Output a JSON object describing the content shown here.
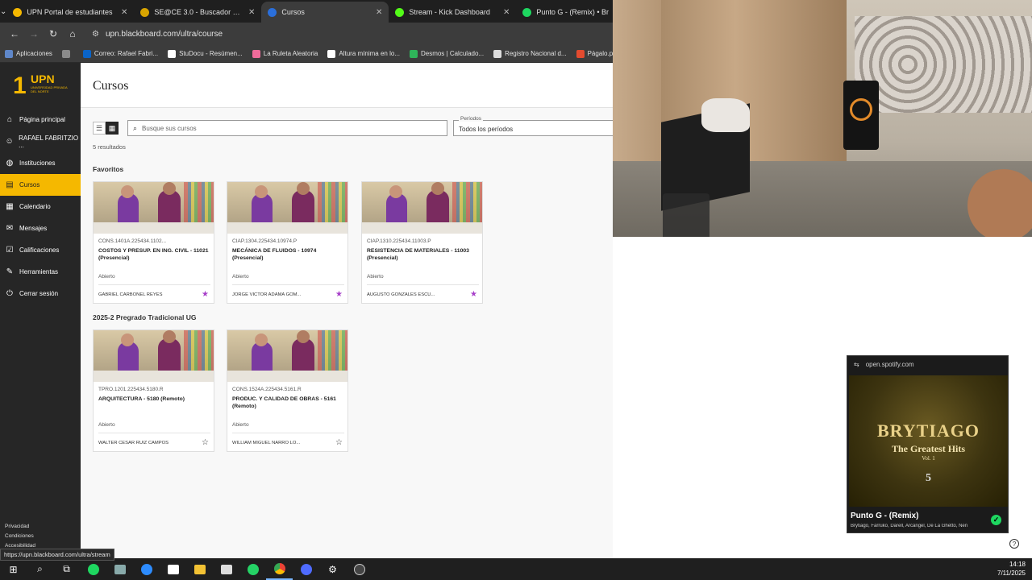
{
  "browser": {
    "tabs": [
      {
        "title": "UPN Portal de estudiantes",
        "color": "#f5b800",
        "active": false
      },
      {
        "title": "SE@CE 3.0 - Buscador Público",
        "color": "#d8a400",
        "active": false
      },
      {
        "title": "Cursos",
        "color": "#2a6fdb",
        "active": true
      },
      {
        "title": "Stream - Kick Dashboard",
        "color": "#53fc18",
        "active": false
      },
      {
        "title": "Punto G - (Remix) • Br",
        "color": "#1ed760",
        "active": false
      }
    ],
    "url": "upn.blackboard.com/ultra/course",
    "bookmarks": [
      {
        "label": "Aplicaciones",
        "color": "#5f87c9"
      },
      {
        "label": "",
        "color": "#8a8a8a"
      },
      {
        "label": "Correo: Rafael Fabri...",
        "color": "#0a64c8"
      },
      {
        "label": "StuDocu - Resúmen...",
        "color": "#ffffff"
      },
      {
        "label": "La Ruleta Aleatoria",
        "color": "#f06c9b"
      },
      {
        "label": "Altura mínima en lo...",
        "color": "#ffffff"
      },
      {
        "label": "Desmos | Calculado...",
        "color": "#2fb45a"
      },
      {
        "label": "Registro Nacional d...",
        "color": "#dddddd"
      },
      {
        "label": "Págalo.pe",
        "color": "#e34b2f"
      }
    ]
  },
  "sidebar": {
    "logo_text": "UPN",
    "logo_sub": "UNIVERSIDAD PRIVADA DEL NORTE",
    "items": [
      {
        "label": "Página principal",
        "icon": "⌂",
        "active": false
      },
      {
        "label": "RAFAEL FABRITZIO ...",
        "icon": "☺",
        "active": false
      },
      {
        "label": "Instituciones",
        "icon": "◍",
        "active": false
      },
      {
        "label": "Cursos",
        "icon": "▤",
        "active": true
      },
      {
        "label": "Calendario",
        "icon": "▦",
        "active": false
      },
      {
        "label": "Mensajes",
        "icon": "✉",
        "active": false
      },
      {
        "label": "Calificaciones",
        "icon": "☑",
        "active": false
      },
      {
        "label": "Herramientas",
        "icon": "✎",
        "active": false
      },
      {
        "label": "Cerrar sesión",
        "icon": "⏻",
        "active": false
      }
    ],
    "footer_links": [
      "Privacidad",
      "Condiciones",
      "Accesibilidad"
    ],
    "status_url": "https://upn.blackboard.com/ultra/stream"
  },
  "main": {
    "title": "Cursos",
    "search_placeholder": "Busque sus cursos",
    "periods_label": "Períodos",
    "periods_value": "Todos los períodos",
    "results": "5 resultados",
    "section_favorites": "Favoritos",
    "section_term": "2025-2 Pregrado Tradicional UG",
    "favorites": [
      {
        "code": "CONS.1401A.225434.1102...",
        "name": "COSTOS Y PRESUP. EN ING. CIVIL - 11021 (Presencial)",
        "state": "Abierto",
        "teacher": "GABRIEL CARBONEL REYES",
        "favorite": true
      },
      {
        "code": "CIAP.1304.225434.10974.P",
        "name": "MECÁNICA DE FLUIDOS - 10974 (Presencial)",
        "state": "Abierto",
        "teacher": "JORGE VICTOR ADAMA GOM...",
        "favorite": true
      },
      {
        "code": "CIAP.1310.225434.11003.P",
        "name": "RESISTENCIA DE MATERIALES - 11003 (Presencial)",
        "state": "Abierto",
        "teacher": "AUGUSTO GONZALES ESCU...",
        "favorite": true
      }
    ],
    "term_courses": [
      {
        "code": "TPRO.1201.225434.5180.R",
        "name": "ARQUITECTURA - 5180 (Remoto)",
        "state": "Abierto",
        "teacher": "WALTER CESAR RUIZ CAMPOS",
        "favorite": false
      },
      {
        "code": "CONS.1524A.225434.5161.R",
        "name": "PRODUC. Y CALIDAD DE OBRAS - 5161 (Remoto)",
        "state": "Abierto",
        "teacher": "WILLIAM MIGUEL NARRO LO...",
        "favorite": false
      }
    ]
  },
  "spotify": {
    "site": "open.spotify.com",
    "album_line1": "BRYTIAGO",
    "album_line2": "The Greatest Hits",
    "album_line3": "Vol. 1",
    "album_mark": "5",
    "track": "Punto G - (Remix)",
    "artists": "Brytiago, Farruko, Darell, Arcángel, De La Ghetto, Ñen"
  },
  "taskbar": {
    "time": "14:18",
    "date": "7/11/2025"
  }
}
